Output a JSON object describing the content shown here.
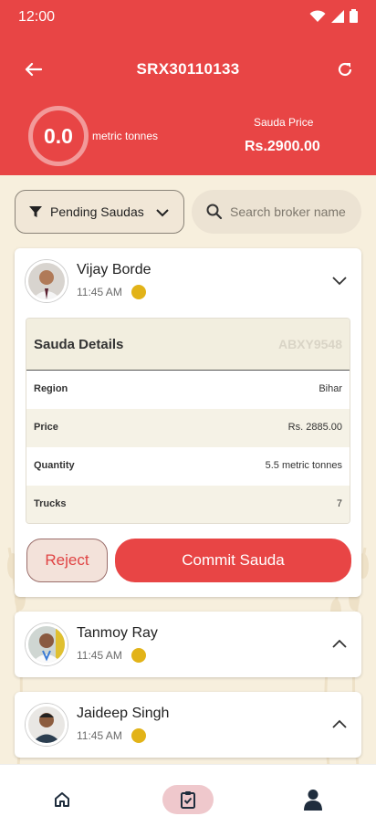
{
  "status_bar": {
    "time": "12:00"
  },
  "appbar": {
    "title": "SRX30110133"
  },
  "summary": {
    "quantity_value": "0.0",
    "quantity_unit": "metric tonnes",
    "price_label": "Sauda Price",
    "price_value": "Rs.2900.00"
  },
  "filter": {
    "label": "Pending Saudas"
  },
  "search": {
    "placeholder": "Search broker name"
  },
  "brokers": [
    {
      "name": "Vijay Borde",
      "time": "11:45 AM",
      "status_color": "#e2b318",
      "expanded": true,
      "details": {
        "title": "Sauda Details",
        "code": "ABXY9548",
        "rows": [
          {
            "key": "Region",
            "value": "Bihar"
          },
          {
            "key": "Price",
            "value": "Rs. 2885.00"
          },
          {
            "key": "Quantity",
            "value": "5.5 metric tonnes"
          },
          {
            "key": "Trucks",
            "value": "7"
          }
        ]
      },
      "actions": {
        "reject": "Reject",
        "commit": "Commit Sauda"
      }
    },
    {
      "name": "Tanmoy Ray",
      "time": "11:45 AM",
      "status_color": "#e2b318",
      "expanded": false
    },
    {
      "name": "Jaideep Singh",
      "time": "11:45 AM",
      "status_color": "#e2b318",
      "expanded": false
    }
  ],
  "bottom_nav": {
    "items": [
      {
        "icon": "home-icon",
        "active": false
      },
      {
        "icon": "clipboard-check-icon",
        "active": true
      },
      {
        "icon": "person-icon",
        "active": false
      }
    ]
  },
  "colors": {
    "primary": "#e84545",
    "background": "#f7efdd",
    "status_dot": "#e2b318"
  }
}
